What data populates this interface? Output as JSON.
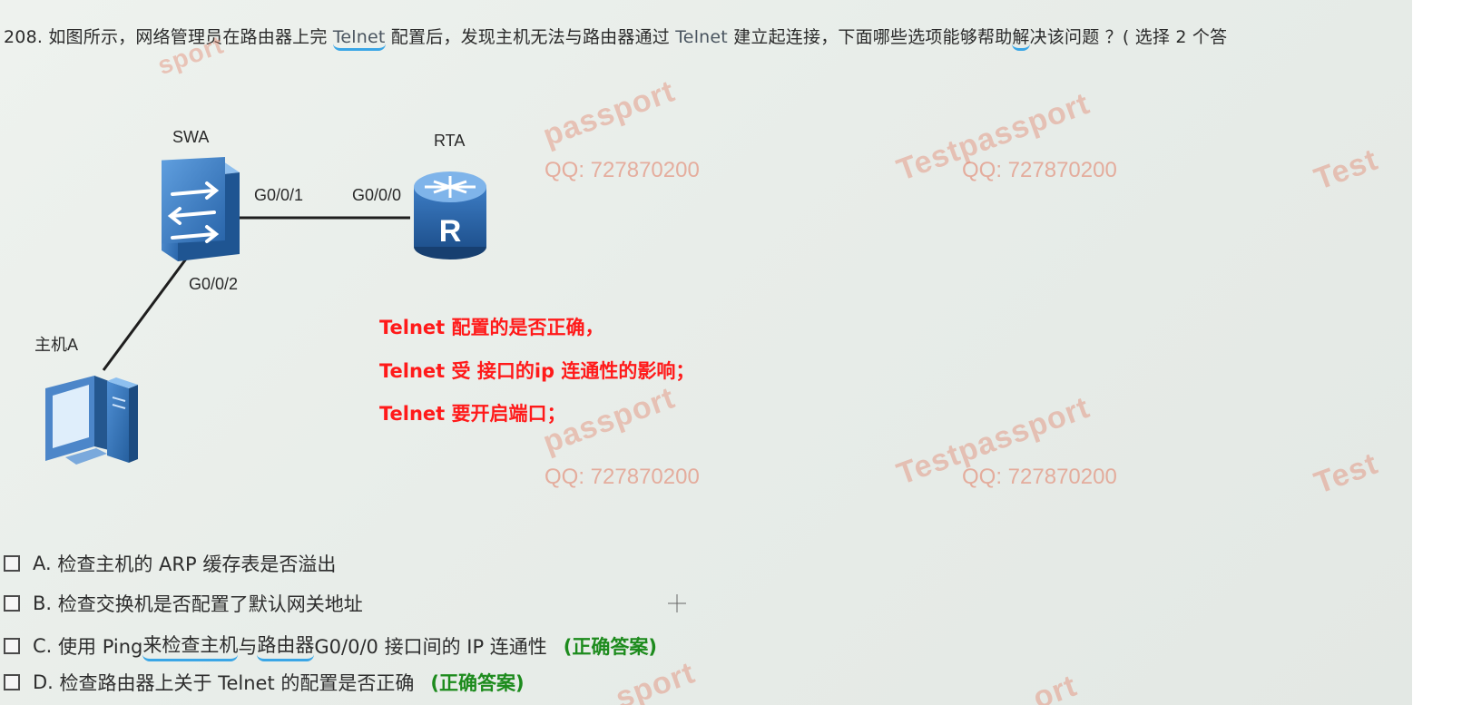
{
  "question": {
    "number": "208.",
    "part1": "如图所示，网络管理员在路由器上完 ",
    "telnet1": "Telnet",
    "part2": " 配置后，发现主机无法与路由器通过 ",
    "telnet2": "Telnet",
    "part3": " 建立起连接，下面哪些选项能够帮助",
    "underlined": "解",
    "part4": "决该问题 ？( 选择 2 个答"
  },
  "diagram": {
    "switch_label": "SWA",
    "router_label": "RTA",
    "router_letter": "R",
    "host_label": "主机A",
    "port_swa_g001": "G0/0/1",
    "port_rta_g000": "G0/0/0",
    "port_swa_g002": "G0/0/2"
  },
  "annotations": [
    "Telnet 配置的是否正确，",
    "Telnet 受 接口的ip 连通性的影响；",
    "Telnet 要开启端口；"
  ],
  "watermarks": {
    "passport": "passport",
    "testpassport": "Testpassport",
    "test": "Test",
    "qq": "QQ: 727870200",
    "sport": "sport",
    "ort": "ort"
  },
  "options": [
    {
      "letter": "A.",
      "text": "检查主机的  ARP 缓存表是否溢出",
      "correct": ""
    },
    {
      "letter": "B.",
      "text": "检查交换机是否配置了默认网关地址",
      "correct": ""
    },
    {
      "letter": "C.",
      "text_pre": "使用  Ping ",
      "text_ul1": "来检查主机",
      "text_mid": "与",
      "text_ul2": "路由器",
      "text_post": "  G0/0/0 接口间的  IP 连通性",
      "correct": "(正确答案)"
    },
    {
      "letter": "D.",
      "text": "检查路由器上关于 Telnet 的配置是否正确",
      "correct": "(正确答案)"
    }
  ],
  "colors": {
    "annotation_red": "#ff1a1a",
    "correct_green": "#1d8b1d",
    "underline_blue": "#3aa6e6",
    "watermark": "#e1785f",
    "device_blue": "#2a6fb5"
  },
  "icons": [
    "switch-icon",
    "router-icon",
    "computer-icon",
    "checkbox-icon",
    "crosshair-cursor-icon"
  ]
}
